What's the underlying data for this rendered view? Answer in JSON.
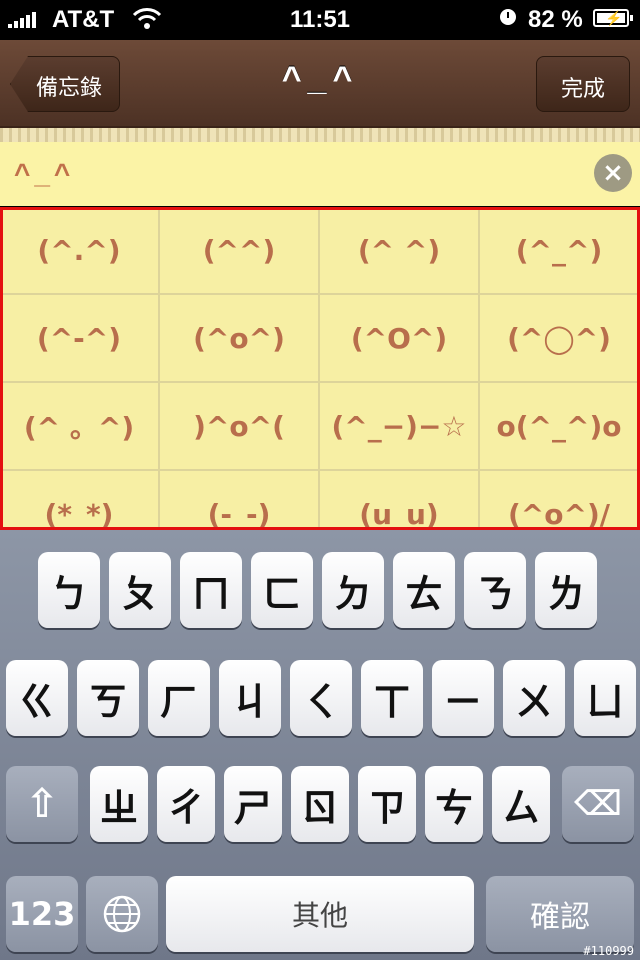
{
  "status_bar": {
    "carrier": "AT&T",
    "time": "11:51",
    "battery_percent": "82 %"
  },
  "nav": {
    "back_label": "備忘錄",
    "title": "^_^",
    "done_label": "完成"
  },
  "search": {
    "text": "^_^",
    "clear_icon": "×"
  },
  "emoticons": [
    "(^.^)",
    "(^^)",
    "(^  ^)",
    "(^_^)",
    "(^-^)",
    "(^o^)",
    "(^O^)",
    "(^◯^)",
    "(^ 。^)",
    ")^o^(",
    "(^_−)−☆",
    "o(^_^)o",
    "(*_*)",
    "(-_-)",
    "(u_u)",
    "(^o^)/"
  ],
  "keyboard": {
    "row1": [
      "ㄅ",
      "ㄆ",
      "ㄇ",
      "ㄈ",
      "ㄉ",
      "ㄊ",
      "ㄋ",
      "ㄌ"
    ],
    "row2": [
      "ㄍ",
      "ㄎ",
      "ㄏ",
      "ㄐ",
      "ㄑ",
      "ㄒ",
      "ㄧ",
      "ㄨ",
      "ㄩ"
    ],
    "row3": [
      "ㄓ",
      "ㄔ",
      "ㄕ",
      "ㄖ",
      "ㄗ",
      "ㄘ",
      "ㄙ"
    ],
    "shift_icon": "⇧",
    "delete_icon": "⌫",
    "numbers_label": "123",
    "globe_icon": "🌐",
    "space_label": "其他",
    "return_label": "確認"
  },
  "watermark": "#110999"
}
